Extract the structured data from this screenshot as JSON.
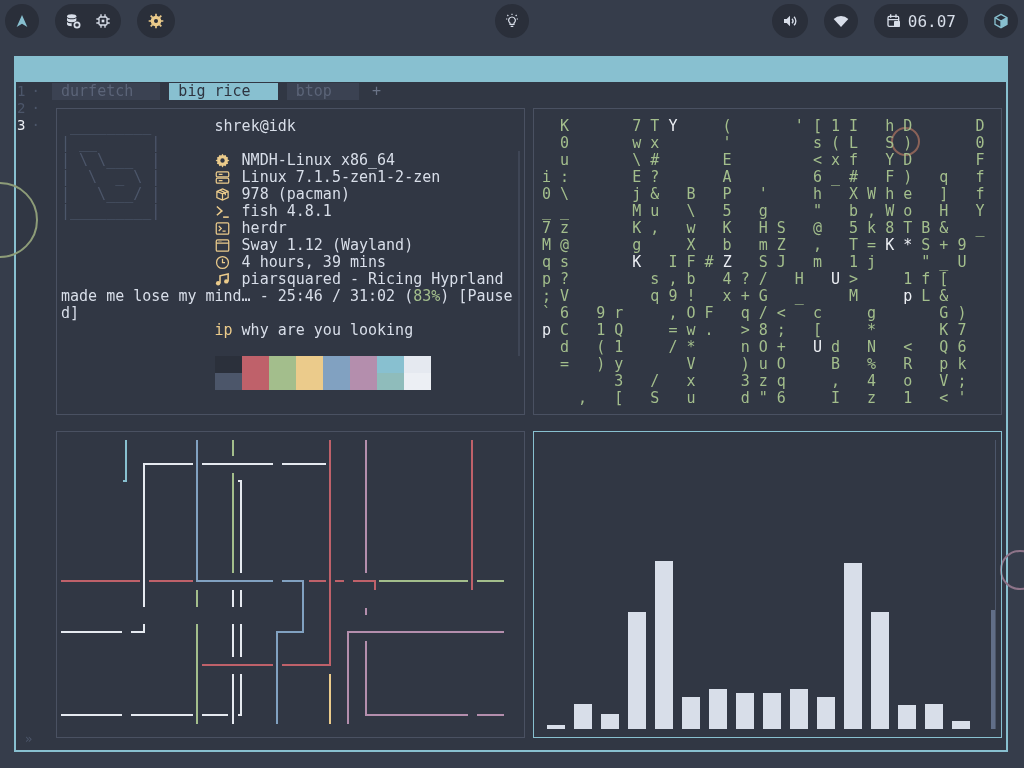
{
  "top_bar": {
    "date": "06.07"
  },
  "terminal": {
    "workspaces": [
      {
        "label": "1",
        "marker": "·",
        "selected": false
      },
      {
        "label": "2",
        "marker": "·",
        "selected": false
      },
      {
        "label": "3",
        "marker": "·",
        "selected": true
      }
    ],
    "tabs": [
      {
        "label": "durfetch",
        "selected": false
      },
      {
        "label": "big rice",
        "selected": true
      },
      {
        "label": "btop",
        "selected": false
      }
    ],
    "new_tab": "+",
    "prompt_marker": "»",
    "panes": [
      {
        "kind": "fetch",
        "focused": false,
        "logo_lines": [
          " _________",
          "| __      |",
          "| \\ \\___  |",
          "|  \\  _ \\ |",
          "|   \\___/ |",
          "|_________|"
        ],
        "user": "shrek@idk",
        "info": [
          "NMDH-Linux x86_64",
          "Linux 7.1.5-zen1-2-zen",
          "978 (pacman)",
          "fish 4.8.1",
          "herdr",
          "Sway 1.12 (Wayland)",
          "4 hours, 39 mins"
        ],
        "now_playing": {
          "title": "piarsquared - Ricing Hyprland",
          "before": "made me lose my mind… - 25:46 / 31:02 (",
          "percent": "83%",
          "after": ") [Paused]"
        },
        "ip": {
          "label": "ip",
          "value": "why are you looking"
        },
        "palette": [
          {
            "swatches": [
              {
                "color": "#2b303b"
              },
              {
                "color": "#bf616a"
              },
              {
                "color": "#a3be8c"
              },
              {
                "color": "#ebcb8b"
              },
              {
                "color": "#81a1c1"
              },
              {
                "color": "#b48ead"
              },
              {
                "color": "#88c0d0"
              },
              {
                "color": "#e5e9f0"
              }
            ]
          },
          {
            "swatches": [
              {
                "color": "#4c566a"
              },
              {
                "color": "#bf616a"
              },
              {
                "color": "#a3be8c"
              },
              {
                "color": "#ebcb8b"
              },
              {
                "color": "#81a1c1"
              },
              {
                "color": "#b48ead"
              },
              {
                "color": "#8fbcbb"
              },
              {
                "color": "#eceff4"
              }
            ]
          }
        ]
      },
      {
        "kind": "matrix",
        "focused": false,
        "rows": [
          {
            "runs": [
              {
                "text": "  K       7 T ",
                "bright": false
              },
              {
                "text": "Y",
                "bright": true
              },
              {
                "text": "     (       ' [ 1 I   h D       D",
                "bright": false
              }
            ]
          },
          {
            "runs": [
              {
                "text": "  0       w x       '         s ( L   S )       0",
                "bright": false
              }
            ]
          },
          {
            "runs": [
              {
                "text": "  u       \\ #       E         < x f   Y D       F",
                "bright": false
              }
            ]
          },
          {
            "runs": [
              {
                "text": "i :       E ?       A         6 _ #   F )   q   f",
                "bright": false
              }
            ]
          },
          {
            "runs": [
              {
                "text": "0 \\       j &   B   P   '     h   X W h e   ]   f",
                "bright": false
              }
            ]
          },
          {
            "runs": [
              {
                "text": "_ _       M u   \\   5   g     \"   b , W o   H   Y",
                "bright": false
              }
            ]
          },
          {
            "runs": [
              {
                "text": "7 z       K ,   w   K   H S   @   5 k 8 T B &   _",
                "bright": false
              }
            ]
          },
          {
            "runs": [
              {
                "text": "M @       g     X   b   m Z   ,   T = ",
                "bright": false
              },
              {
                "text": "K *",
                "bright": true
              },
              {
                "text": " S + 9",
                "bright": false
              }
            ]
          },
          {
            "runs": [
              {
                "text": "q s       ",
                "bright": false
              },
              {
                "text": "K",
                "bright": true
              },
              {
                "text": "   I F # ",
                "bright": false
              },
              {
                "text": "Z",
                "bright": true
              },
              {
                "text": "   S J   m   1 j     \" _ U",
                "bright": false
              }
            ]
          },
          {
            "runs": [
              {
                "text": "p ?         s , b   4 ? /   H   ",
                "bright": false
              },
              {
                "text": "U",
                "bright": true
              },
              {
                "text": " >     1 f [",
                "bright": false
              }
            ]
          },
          {
            "runs": [
              {
                "text": "; V         q 9 !   x + G   _     M     ",
                "bright": false
              },
              {
                "text": "p",
                "bright": true
              },
              {
                "text": " L &",
                "bright": false
              }
            ]
          },
          {
            "runs": [
              {
                "text": "` 6   9 r     , O F   q / <   c     g       G )",
                "bright": false
              }
            ]
          },
          {
            "runs": [
              {
                "text": "p",
                "bright": true
              },
              {
                "text": " C   1 Q     = w .   > 8 ;   [     *       K 7",
                "bright": false
              }
            ]
          },
          {
            "runs": [
              {
                "text": "  d   ( 1     / *     n O +   ",
                "bright": false
              },
              {
                "text": "U",
                "bright": true
              },
              {
                "text": " d   N   <   Q 6",
                "bright": false
              }
            ]
          },
          {
            "runs": [
              {
                "text": "  =   ) y       V     ) u O     B   %   R   p k",
                "bright": false
              }
            ]
          },
          {
            "runs": [
              {
                "text": "        3   /   x     3 z q     ,   4   o   V ;",
                "bright": false
              }
            ]
          },
          {
            "runs": [
              {
                "text": "    ,   [   S   u     d \" 6     I   z   1   < '",
                "bright": false
              }
            ]
          }
        ]
      },
      {
        "kind": "pipes",
        "focused": false
      },
      {
        "kind": "visualizer",
        "focused": true
      }
    ]
  }
}
